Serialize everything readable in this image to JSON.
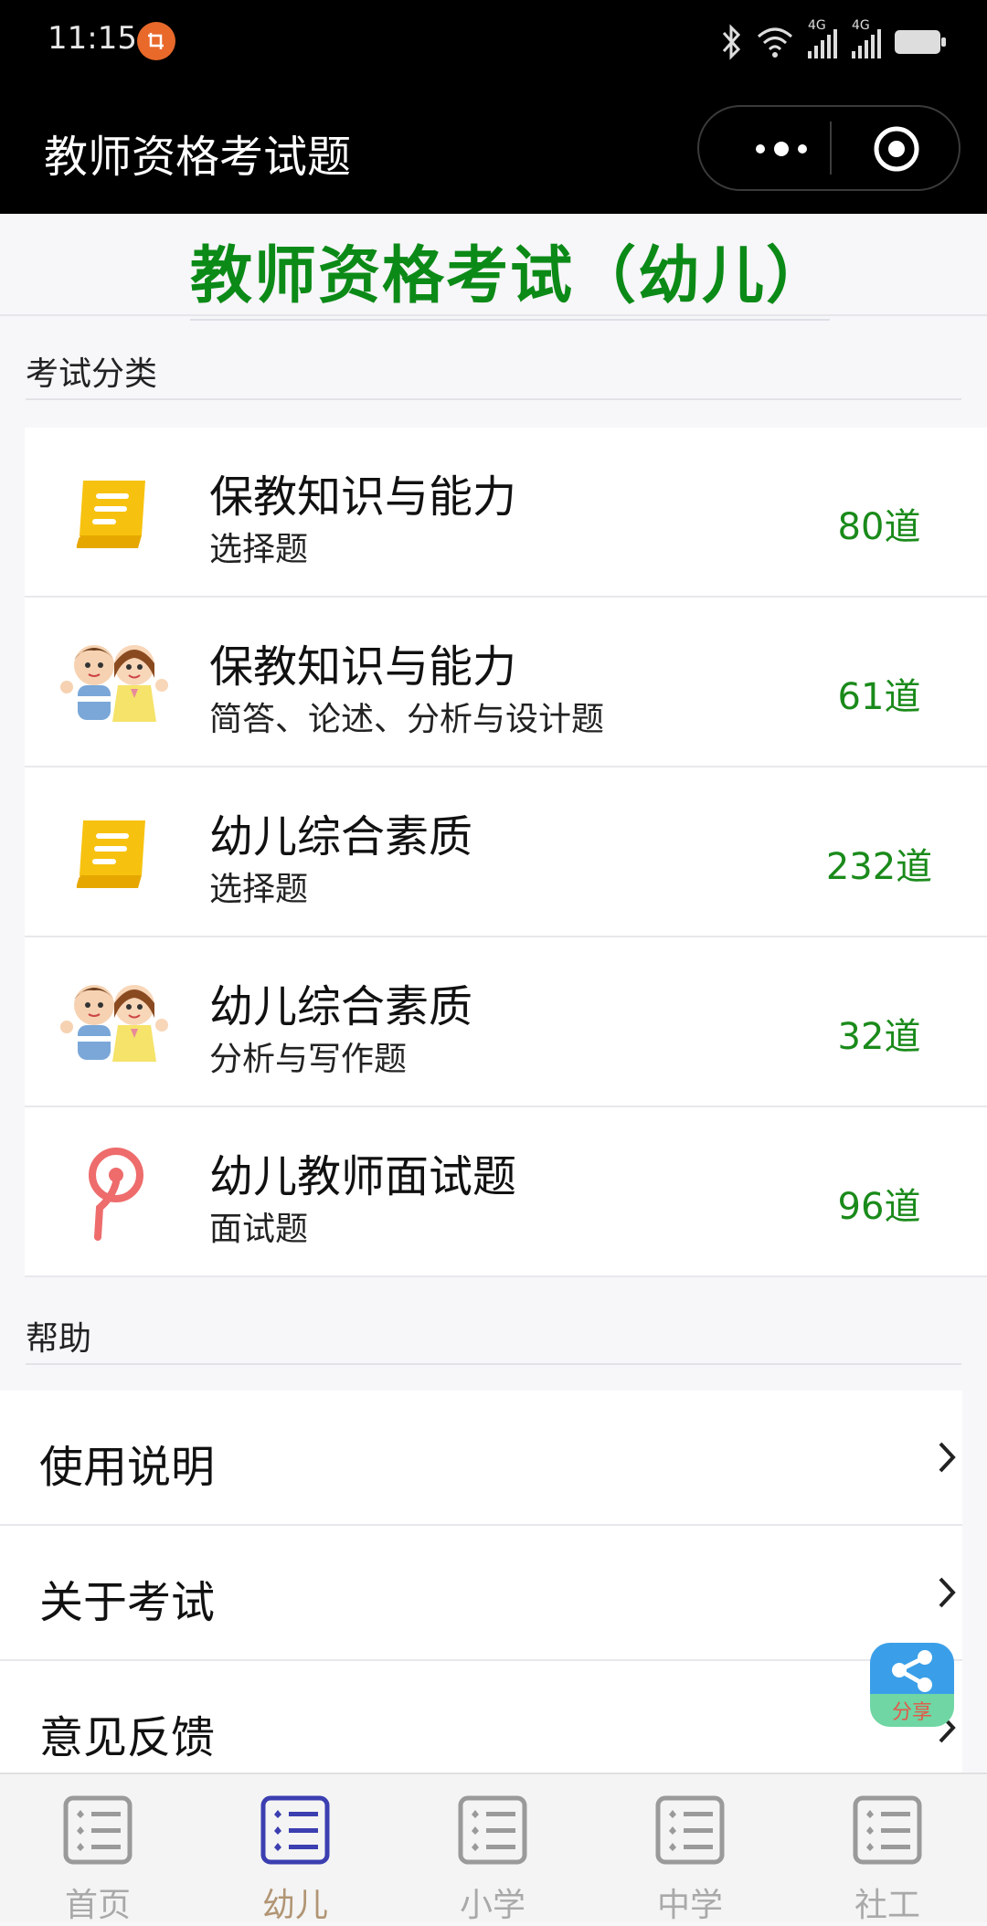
{
  "status_bar": {
    "time": "11:15",
    "network_1": "4G",
    "network_2": "4G"
  },
  "nav": {
    "title": "教师资格考试题"
  },
  "headline": "教师资格考试（幼儿）",
  "sections": {
    "categories_label": "考试分类",
    "help_label": "帮助"
  },
  "categories": [
    {
      "name": "保教知识与能力",
      "subtitle": "选择题",
      "count": "80道",
      "icon": "yellow-book-icon"
    },
    {
      "name": "保教知识与能力",
      "subtitle": "简答、论述、分析与设计题",
      "count": "61道",
      "icon": "kids-icon"
    },
    {
      "name": "幼儿综合素质",
      "subtitle": "选择题",
      "count": "232道",
      "icon": "yellow-book-icon"
    },
    {
      "name": "幼儿综合素质",
      "subtitle": "分析与写作题",
      "count": "32道",
      "icon": "kids-icon"
    },
    {
      "name": "幼儿教师面试题",
      "subtitle": "面试题",
      "count": "96道",
      "icon": "pin-icon"
    }
  ],
  "help_items": [
    {
      "label": "使用说明"
    },
    {
      "label": "关于考试"
    },
    {
      "label": "意见反馈"
    }
  ],
  "share_button": {
    "label": "分享"
  },
  "tabs": [
    {
      "label": "首页",
      "active": false
    },
    {
      "label": "幼儿",
      "active": true
    },
    {
      "label": "小学",
      "active": false
    },
    {
      "label": "中学",
      "active": false
    },
    {
      "label": "社工",
      "active": false
    }
  ],
  "colors": {
    "accent_green": "#0c8a17",
    "count_green": "#1a8a1a",
    "tab_active": "#b19574",
    "tab_active_icon": "#3b3fb0"
  }
}
